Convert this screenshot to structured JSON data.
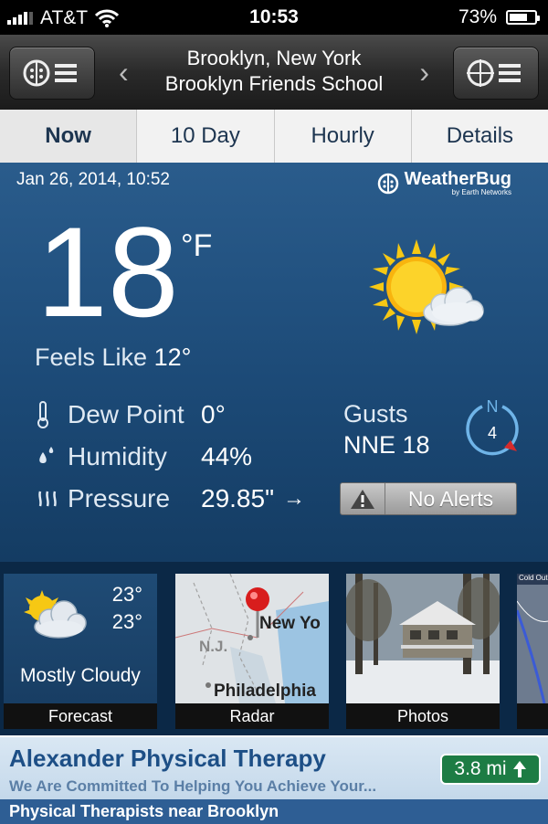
{
  "status_bar": {
    "carrier": "AT&T",
    "time": "10:53",
    "battery": "73%",
    "battery_level": 0.73
  },
  "nav": {
    "city": "Brooklyn, New York",
    "station": "Brooklyn Friends School",
    "left_icon": "forecast-menu-icon",
    "right_icon": "crosshair-menu-icon"
  },
  "tabs": [
    {
      "label": "Now",
      "active": true
    },
    {
      "label": "10 Day",
      "active": false
    },
    {
      "label": "Hourly",
      "active": false
    },
    {
      "label": "Details",
      "active": false
    }
  ],
  "current": {
    "timestamp": "Jan 26, 2014, 10:52",
    "brand": "WeatherBug",
    "brand_sub": "by Earth Networks",
    "temperature": "18",
    "unit": "°F",
    "feels_like_label": "Feels Like",
    "feels_like_value": "12°",
    "dew_point_label": "Dew Point",
    "dew_point_value": "0°",
    "humidity_label": "Humidity",
    "humidity_value": "44%",
    "pressure_label": "Pressure",
    "pressure_value": "29.85\"",
    "gusts_label": "Gusts",
    "gusts_value": "NNE 18",
    "compass_letter": "N",
    "wind_speed": "4",
    "alerts_label": "No Alerts",
    "condition_icon": "partly-sunny-icon"
  },
  "tiles": {
    "forecast": {
      "caption": "Forecast",
      "high": "23°",
      "low": "23°",
      "description": "Mostly Cloudy"
    },
    "radar": {
      "caption": "Radar",
      "label_city1": "New Yo",
      "label_city2": "Philadelphia",
      "label_state": "N.J."
    },
    "photos": {
      "caption": "Photos"
    },
    "partial": {
      "label": "Cold Outbrea"
    }
  },
  "ad": {
    "title": "Alexander Physical Therapy",
    "subtitle": "We Are Committed To Helping You Achieve Your...",
    "footer": "Physical Therapists near Brooklyn",
    "distance": "3.8 mi"
  },
  "colors": {
    "panel": "#1c4a77",
    "tabs_text": "#1d3550",
    "ad_green": "#1d7c44"
  }
}
